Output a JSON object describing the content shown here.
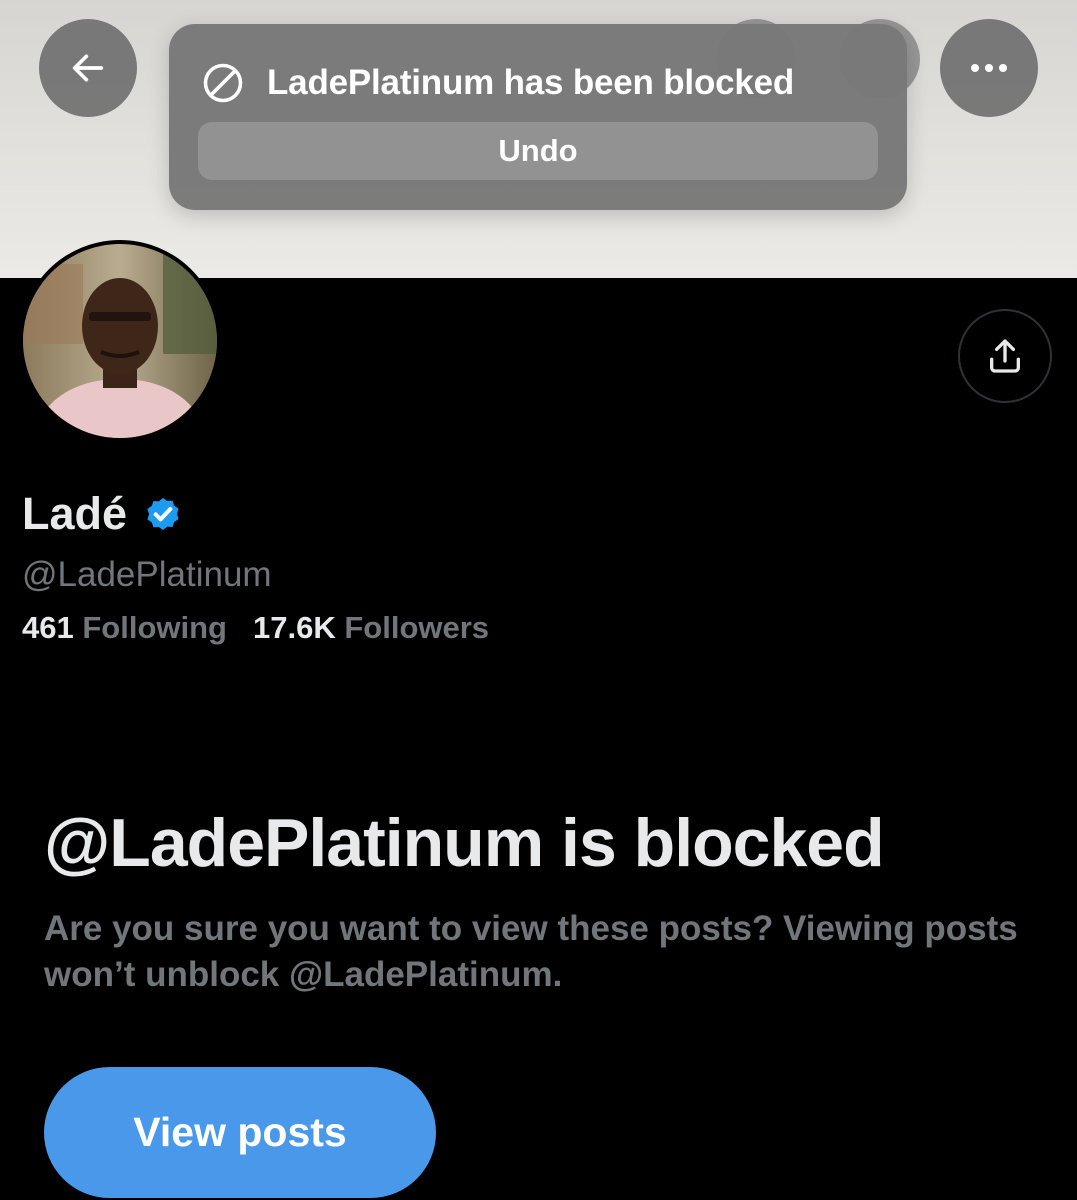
{
  "toast": {
    "message": "LadePlatinum has been blocked",
    "undo_label": "Undo",
    "icon": "blocked-icon"
  },
  "header": {
    "back_icon": "back-arrow-icon",
    "more_icon": "more-horizontal-icon",
    "share_icon": "share-upload-icon"
  },
  "profile": {
    "name": "Ladé",
    "verified": true,
    "handle": "@LadePlatinum",
    "following_count": "461",
    "following_label": "Following",
    "followers_count": "17.6K",
    "followers_label": "Followers"
  },
  "blocked_notice": {
    "title": "@LadePlatinum is blocked",
    "description": "Are you sure you want to view these posts? Viewing posts won’t unblock @LadePlatinum.",
    "button_label": "View posts"
  },
  "colors": {
    "accent": "#4a98e9",
    "verified_badge": "#1d9bf0",
    "background": "#000000",
    "primary_text": "#e7e9ea",
    "secondary_text": "#71767b"
  }
}
